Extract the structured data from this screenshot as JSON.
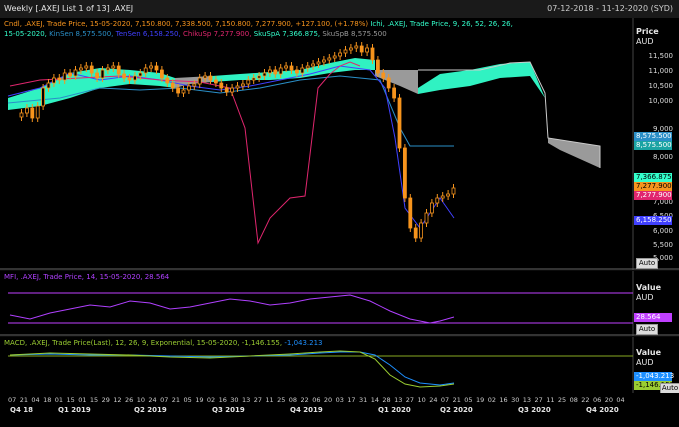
{
  "window": {
    "title": "Weekly [.AXEJ List 1 of 13] .AXEJ",
    "date_range": "07-12-2018 - 11-12-2020 (SYD)"
  },
  "price_panel": {
    "legend_line1": {
      "cndl": "Cndl, .AXEJ, Trade Price, 15-05-2020, 7,150.800, 7,338.500, 7,150.800, 7,277.900, +127.100, (+1.78%)",
      "ichi": "Ichi, .AXEJ, Trade Price, 9, 26, 52, 26, 26,"
    },
    "legend_line2": {
      "date": "15-05-2020,",
      "kinsen": "KinSen 8,575.500,",
      "tensen": "TenSen 6,158.250,",
      "chikusp": "ChikuSp 7,277.900,",
      "skuspa": "SkuSpA 7,366.875,",
      "skuspb": "SkuSpB 8,575.500"
    },
    "axis_header": "Price",
    "axis_unit": "AUD",
    "ticks": [
      "11,500",
      "11,000",
      "10,500",
      "10,000",
      "9,000",
      "8,000",
      "7,000",
      "6,500",
      "6,000",
      "5,500",
      "5,000"
    ],
    "value_tags": [
      "8,575.500",
      "8,575.500",
      "7,366.875",
      "7,277.900",
      "7,277.900",
      "6,158.250"
    ],
    "auto_label": "Auto",
    "colors": {
      "candle_up": "#f7941d",
      "cloud_bull": "#33ffcc",
      "cloud_bear": "#9a9a9a",
      "kijun": "#2a8fc8",
      "tenkan": "#4040ff",
      "chikou": "#e0266e"
    }
  },
  "mfi_panel": {
    "legend": "MFI, .AXEJ, Trade Price, 14, 15-05-2020, 28.564",
    "axis_header": "Value",
    "axis_unit": "AUD",
    "value_tag": "28.564",
    "auto_label": "Auto",
    "colors": {
      "line": "#b040ff",
      "band": "#c040ff"
    }
  },
  "macd_panel": {
    "legend_macd": "MACD, .AXEJ, Trade Price(Last), 12, 26, 9, Exponential, 15-05-2020, -1,146.155,",
    "legend_signal": "-1,043.213",
    "axis_header": "Value",
    "axis_unit": "AUD",
    "value_tags": [
      "-1,043.213",
      "-1,146.155"
    ],
    "auto_label": "Auto",
    "colors": {
      "macd": "#9acd32",
      "signal": "#1e90ff",
      "zero": "#88aa22"
    }
  },
  "x_axis": {
    "dates": [
      "07",
      "21",
      "04",
      "18",
      "01",
      "15",
      "01",
      "15",
      "29",
      "12",
      "26",
      "10",
      "24",
      "07",
      "21",
      "05",
      "19",
      "02",
      "16",
      "30",
      "13",
      "27",
      "11",
      "25",
      "08",
      "22",
      "06",
      "20",
      "03",
      "17",
      "31",
      "14",
      "28",
      "13",
      "27",
      "10",
      "24",
      "07",
      "21",
      "05",
      "19",
      "02",
      "16",
      "30",
      "13",
      "27",
      "11",
      "25",
      "08",
      "22",
      "06",
      "20",
      "04"
    ],
    "quarters": [
      "Q4 18",
      "Q1 2019",
      "Q2 2019",
      "Q3 2019",
      "Q4 2019",
      "Q1 2020",
      "Q2 2020",
      "Q3 2020",
      "Q4 2020"
    ]
  }
}
